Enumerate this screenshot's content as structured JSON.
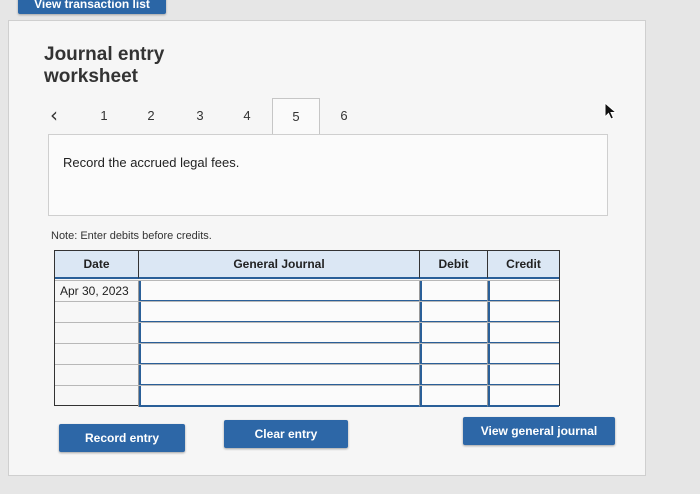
{
  "header": {
    "top_button_label": "View transaction list"
  },
  "worksheet": {
    "title": "Journal entry worksheet",
    "tabs": [
      "1",
      "2",
      "3",
      "4",
      "5",
      "6"
    ],
    "active_tab": "5",
    "instruction": "Record the accrued legal fees.",
    "note": "Note: Enter debits before credits."
  },
  "journal": {
    "columns": [
      "Date",
      "General Journal",
      "Debit",
      "Credit"
    ],
    "rows": [
      {
        "date": "Apr 30, 2023",
        "account": "",
        "debit": "",
        "credit": ""
      },
      {
        "date": "",
        "account": "",
        "debit": "",
        "credit": ""
      },
      {
        "date": "",
        "account": "",
        "debit": "",
        "credit": ""
      },
      {
        "date": "",
        "account": "",
        "debit": "",
        "credit": ""
      },
      {
        "date": "",
        "account": "",
        "debit": "",
        "credit": ""
      },
      {
        "date": "",
        "account": "",
        "debit": "",
        "credit": ""
      }
    ]
  },
  "buttons": {
    "record": "Record entry",
    "clear": "Clear entry",
    "view_journal": "View general journal"
  },
  "colors": {
    "accent": "#2d67a7",
    "header_bg": "#dbe7f4"
  }
}
